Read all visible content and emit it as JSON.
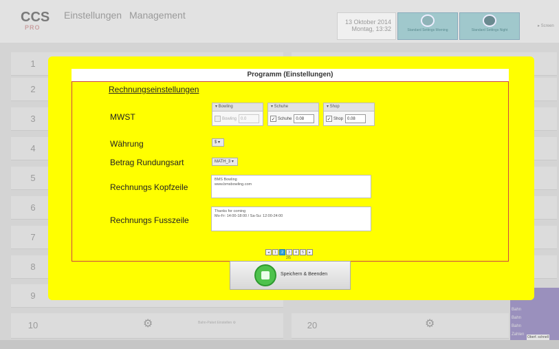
{
  "header": {
    "logo": "CCS",
    "logo_sub": "PRO",
    "menu": [
      "Einstellungen",
      "Management"
    ],
    "date": "13 Oktober 2014",
    "time": "Montag, 13:32",
    "quick_buttons": [
      "Standard Settings Morning",
      "Standard Settings Night"
    ],
    "top_right_label": "▸ Screen"
  },
  "lanes_left": [
    "1",
    "2",
    "3",
    "4",
    "5",
    "6",
    "7",
    "8",
    "9",
    "10"
  ],
  "lane_right_bottom": "20",
  "bottom_mid_text": "Bahn-Paket Einstellen ⚙",
  "purple_panel_lines": [
    "Bahn",
    "Bahn",
    "Bahn",
    "Zahlen"
  ],
  "purple_footer": "Oberf. schnell",
  "modal": {
    "title": "Programm (Einstellungen)",
    "section": "Rechnungseinstellungen",
    "labels": {
      "mwst": "MWST",
      "waehrung": "Währung",
      "rundung": "Betrag Rundungsart",
      "kopf": "Rechnungs Kopfzeile",
      "fuss": "Rechnungs Fusszeile"
    },
    "mwst_boxes": [
      {
        "header": "▾ Bowling",
        "label": "Bowling",
        "value": "0.0",
        "checked": false,
        "enabled": false
      },
      {
        "header": "▾ Schuhe",
        "label": "Schuhe",
        "value": "0.08",
        "checked": true,
        "enabled": true
      },
      {
        "header": "▾ Shop",
        "label": "Shop",
        "value": "0.08",
        "checked": true,
        "enabled": true
      }
    ],
    "waehrung_value": "$",
    "rundung_value": "MATH_3",
    "kopfzeile_lines": [
      "BMS Bowling",
      "www.bmsbowling.com"
    ],
    "fusszeile_lines": [
      "Thanks for coming",
      "Mo-Fr: 14:00-18:00 / Sa-Su: 12:00-24:00"
    ],
    "pager": {
      "pages": [
        "◂",
        "1",
        "2",
        "3",
        "4",
        "5",
        "▸"
      ],
      "active": "2",
      "count": "2/5"
    },
    "save_button_label": "Speichern & Beenden"
  }
}
